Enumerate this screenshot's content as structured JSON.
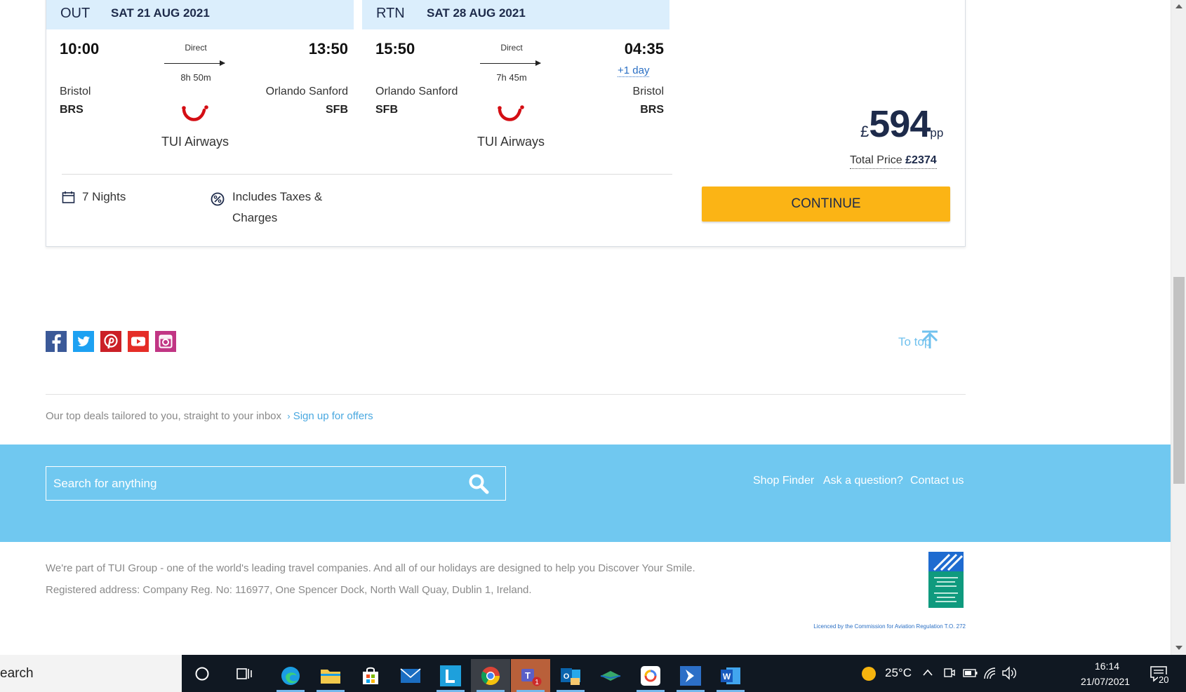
{
  "outbound": {
    "direction": "OUT",
    "date": "SAT 21 AUG 2021",
    "depart_time": "10:00",
    "arrive_time": "13:50",
    "stops": "Direct",
    "duration": "8h 50m",
    "from_city": "Bristol",
    "from_code": "BRS",
    "to_city": "Orlando Sanford",
    "to_code": "SFB",
    "airline": "TUI Airways"
  },
  "return": {
    "direction": "RTN",
    "date": "SAT 28 AUG 2021",
    "depart_time": "15:50",
    "arrive_time": "04:35",
    "plus_day": "+1 day",
    "stops": "Direct",
    "duration": "7h 45m",
    "from_city": "Orlando Sanford",
    "from_code": "SFB",
    "to_city": "Bristol",
    "to_code": "BRS",
    "airline": "TUI Airways"
  },
  "meta": {
    "nights": "7 Nights",
    "taxes_line1": "Includes Taxes &",
    "taxes_line2": "Charges"
  },
  "price": {
    "currency": "£",
    "amount": "594",
    "per": "pp",
    "total_label": "Total Price",
    "total_value": "£2374",
    "continue_label": "CONTINUE"
  },
  "social": {
    "icons": [
      "facebook-icon",
      "twitter-icon",
      "pinterest-icon",
      "youtube-icon",
      "instagram-icon"
    ],
    "to_top": "To top"
  },
  "newsletter": {
    "text": "Our top deals tailored to you, straight to your inbox",
    "link": "Sign up for offers"
  },
  "footer": {
    "search_placeholder": "Search for anything",
    "links": [
      "Shop Finder",
      "Ask a question?",
      "Contact us"
    ],
    "legal_line1": "We're part of TUI Group - one of the world's leading travel companies. And all of our holidays are designed to help you Discover Your Smile.",
    "legal_line2": "Registered address: Company Reg. No: 116977, One Spencer Dock, North Wall Quay, Dublin 1, Ireland.",
    "licence": "Licenced by the Commission for Aviation Regulation T.O. 272"
  },
  "taskbar": {
    "search_text": "earch",
    "weather": "25°C",
    "time": "16:14",
    "date": "21/07/2021",
    "notifications": "20",
    "teams_badge": "1"
  },
  "colors": {
    "accent_blue": "#70c8f0",
    "continue_yellow": "#fbb415",
    "navy": "#1d2a4a",
    "tui_red": "#d40e14"
  }
}
